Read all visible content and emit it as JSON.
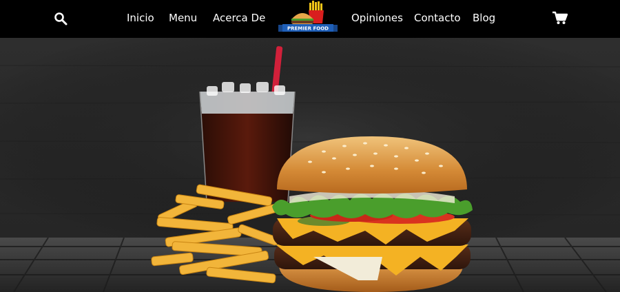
{
  "nav": {
    "items": [
      {
        "label": "Inicio"
      },
      {
        "label": "Menu"
      },
      {
        "label": "Acerca De"
      },
      {
        "label": "Opiniones"
      },
      {
        "label": "Contacto"
      },
      {
        "label": "Blog"
      }
    ],
    "search_icon": "search-icon",
    "cart_icon": "cart-icon"
  },
  "logo": {
    "text": "PREMIER FOOD",
    "colors": {
      "ribbon": "#1f5fb8",
      "fries_box": "#d91e1e",
      "fries": "#f5c518",
      "bun": "#e7a64a"
    }
  },
  "hero": {
    "image": "burger-fries-soda-photo",
    "colors": {
      "wall": "#2a2a2a",
      "table": "#3a3a3a",
      "cheese": "#f4b223",
      "tomato": "#d9331f",
      "lettuce": "#4a9e2c",
      "straw": "#d1203a"
    }
  }
}
